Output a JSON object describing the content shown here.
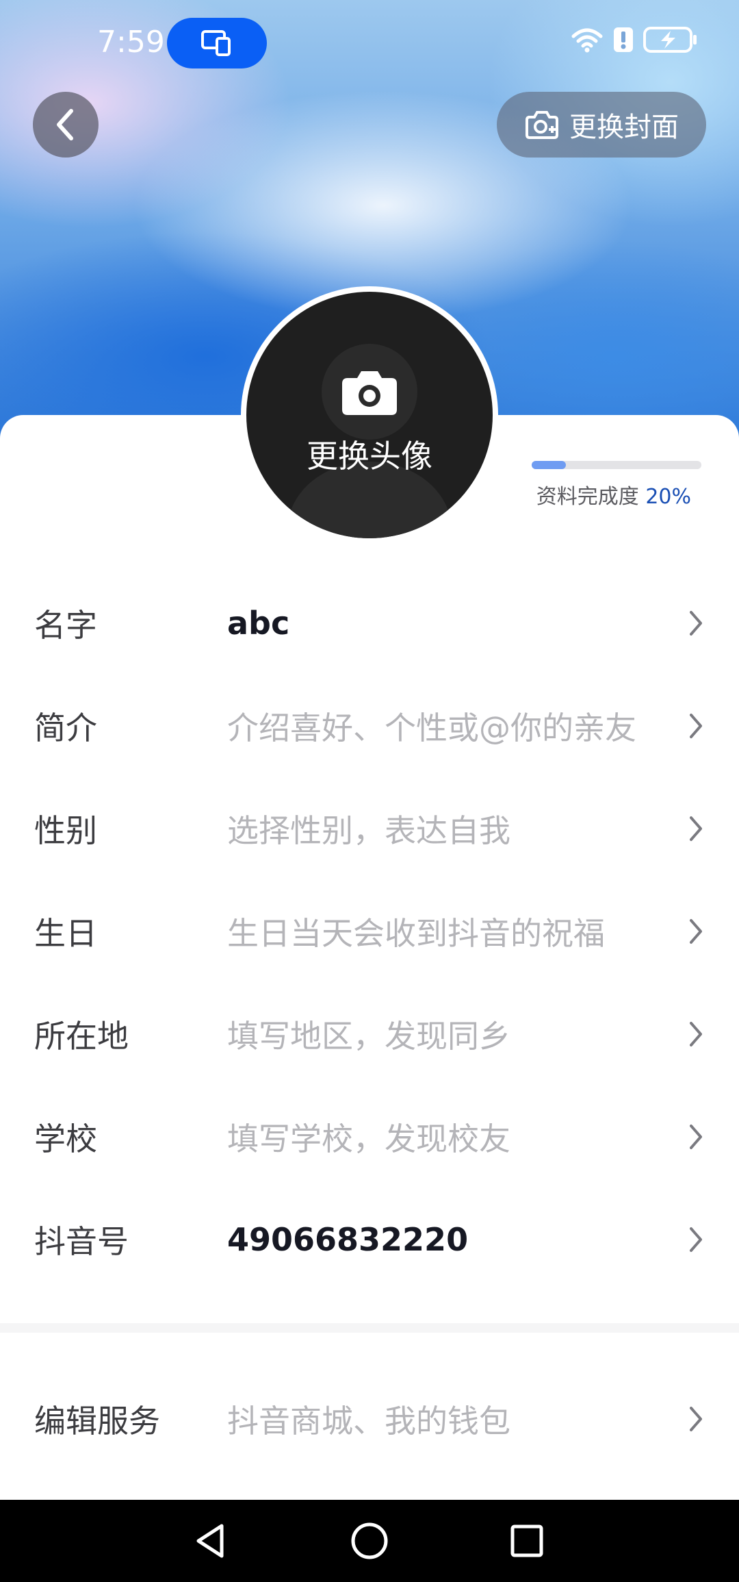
{
  "status_bar": {
    "time": "7:59",
    "icons": [
      "screen-share-icon",
      "wifi-icon",
      "alert-icon",
      "battery-charging-icon"
    ]
  },
  "header": {
    "back_icon": "chevron-left-icon",
    "change_cover_label": "更换封面",
    "change_cover_icon": "camera-plus-icon"
  },
  "avatar": {
    "change_label": "更换头像",
    "icon": "camera-icon"
  },
  "profile_completion": {
    "label": "资料完成度",
    "percent_text": "20%",
    "fraction": 0.2,
    "fill_color": "#6f9cf2"
  },
  "fields": [
    {
      "label": "名字",
      "value": "abc",
      "filled": true
    },
    {
      "label": "简介",
      "value": "介绍喜好、个性或@你的亲友",
      "filled": false
    },
    {
      "label": "性别",
      "value": "选择性别，表达自我",
      "filled": false
    },
    {
      "label": "生日",
      "value": "生日当天会收到抖音的祝福",
      "filled": false
    },
    {
      "label": "所在地",
      "value": "填写地区，发现同乡",
      "filled": false
    },
    {
      "label": "学校",
      "value": "填写学校，发现校友",
      "filled": false
    },
    {
      "label": "抖音号",
      "value": "49066832220",
      "filled": true
    }
  ],
  "services": {
    "label": "编辑服务",
    "value": "抖音商城、我的钱包"
  },
  "navigation": {
    "icons": [
      "back-triangle-icon",
      "home-circle-icon",
      "recents-square-icon"
    ]
  },
  "colors": {
    "accent_blue": "#0a5ff5",
    "label_text": "#3c3c40",
    "placeholder_text": "#b4b4b8",
    "value_text": "#161823"
  }
}
